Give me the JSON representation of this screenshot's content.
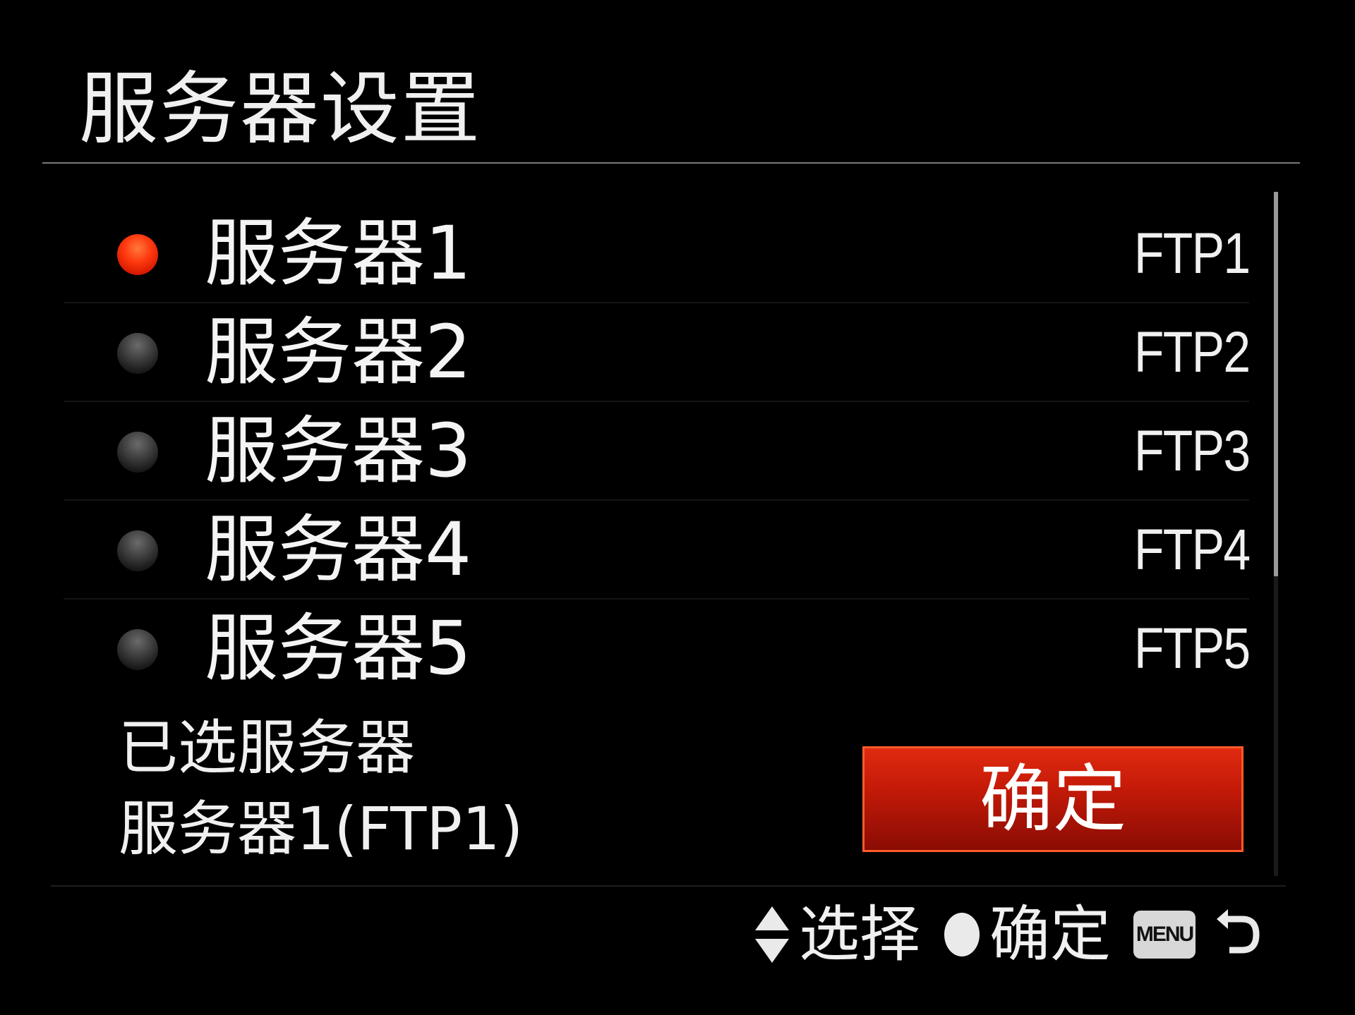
{
  "header": {
    "title": "服务器设置"
  },
  "servers": [
    {
      "name": "服务器1",
      "type": "FTP1",
      "selected": true
    },
    {
      "name": "服务器2",
      "type": "FTP2",
      "selected": false
    },
    {
      "name": "服务器3",
      "type": "FTP3",
      "selected": false
    },
    {
      "name": "服务器4",
      "type": "FTP4",
      "selected": false
    },
    {
      "name": "服务器5",
      "type": "FTP5",
      "selected": false
    }
  ],
  "selection": {
    "label": "已选服务器",
    "value": "服务器1(FTP1)"
  },
  "confirm_button": {
    "label": "确定"
  },
  "footer": {
    "select_hint": "选择",
    "confirm_hint": "确定",
    "menu_label": "MENU"
  },
  "colors": {
    "selected_radio": "#ff3a10",
    "confirm_button": "#c41a08",
    "background": "#000000"
  }
}
